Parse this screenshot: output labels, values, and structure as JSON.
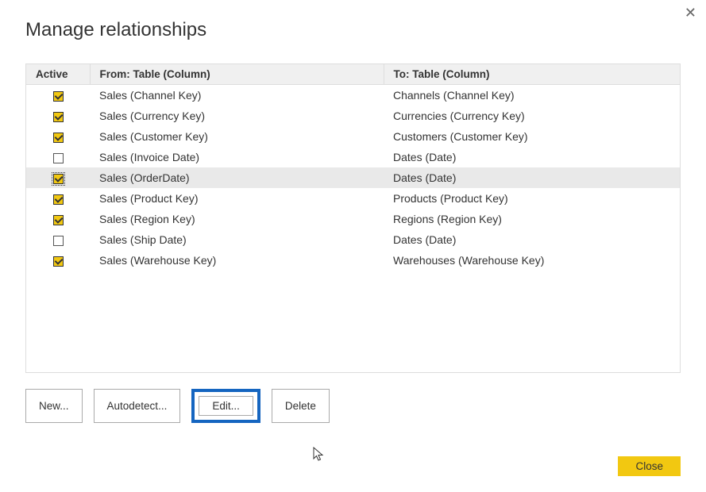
{
  "dialog": {
    "title": "Manage relationships",
    "close_x": "✕"
  },
  "columns": {
    "active": "Active",
    "from": "From: Table (Column)",
    "to": "To: Table (Column)"
  },
  "rows": [
    {
      "active": true,
      "selected": false,
      "focused": false,
      "from": "Sales (Channel Key)",
      "to": "Channels (Channel Key)"
    },
    {
      "active": true,
      "selected": false,
      "focused": false,
      "from": "Sales (Currency Key)",
      "to": "Currencies (Currency Key)"
    },
    {
      "active": true,
      "selected": false,
      "focused": false,
      "from": "Sales (Customer Key)",
      "to": "Customers (Customer Key)"
    },
    {
      "active": false,
      "selected": false,
      "focused": false,
      "from": "Sales (Invoice Date)",
      "to": "Dates (Date)"
    },
    {
      "active": true,
      "selected": true,
      "focused": true,
      "from": "Sales (OrderDate)",
      "to": "Dates (Date)"
    },
    {
      "active": true,
      "selected": false,
      "focused": false,
      "from": "Sales (Product Key)",
      "to": "Products (Product Key)"
    },
    {
      "active": true,
      "selected": false,
      "focused": false,
      "from": "Sales (Region Key)",
      "to": "Regions (Region Key)"
    },
    {
      "active": false,
      "selected": false,
      "focused": false,
      "from": "Sales (Ship Date)",
      "to": "Dates (Date)"
    },
    {
      "active": true,
      "selected": false,
      "focused": false,
      "from": "Sales (Warehouse Key)",
      "to": "Warehouses (Warehouse Key)"
    }
  ],
  "buttons": {
    "new": "New...",
    "autodetect": "Autodetect...",
    "edit": "Edit...",
    "delete": "Delete",
    "close": "Close"
  }
}
